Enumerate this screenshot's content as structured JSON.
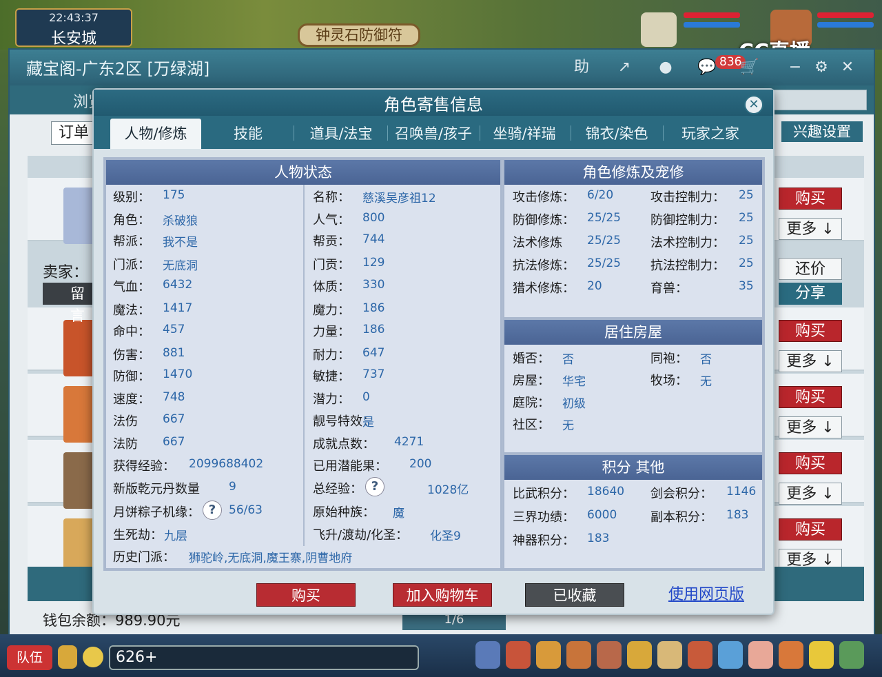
{
  "game": {
    "time": "22:43:37",
    "city": "长安城",
    "amulet": "钟灵石防御符",
    "stream_logo": "CC直播"
  },
  "window": {
    "title": "藏宝阁-广东2区 [万绿湖]",
    "toolbar": [
      "助",
      "↗",
      "●",
      "💬"
    ],
    "badge_count": "836",
    "nav_browse": "浏览",
    "order_btn": "订单",
    "interest_btn": "兴趣设置",
    "seller_label": "卖家：",
    "leave_msg": "留言",
    "counter_offer": "还价",
    "share": "分享",
    "buy": "购买",
    "more": "更多",
    "wallet": "钱包余额：989.90元",
    "pager": "1/6"
  },
  "modal": {
    "title": "角色寄售信息",
    "tabs": [
      "人物/修炼",
      "技能",
      "道具/法宝",
      "召唤兽/孩子",
      "坐骑/祥瑞",
      "锦衣/染色",
      "玩家之家"
    ],
    "sections": {
      "status": "人物状态",
      "cultivation": "角色修炼及宠修",
      "house": "居住房屋",
      "points": "积分 其他"
    },
    "status_left": [
      {
        "l": "级别：",
        "v": "175"
      },
      {
        "l": "角色：",
        "v": "杀破狼"
      },
      {
        "l": "帮派：",
        "v": "我不是"
      },
      {
        "l": "门派：",
        "v": "无底洞"
      },
      {
        "l": "气血：",
        "v": "6432"
      },
      {
        "l": "魔法：",
        "v": "1417"
      },
      {
        "l": "命中：",
        "v": "457"
      },
      {
        "l": "伤害：",
        "v": "881"
      },
      {
        "l": "防御：",
        "v": "1470"
      },
      {
        "l": "速度：",
        "v": "748"
      },
      {
        "l": "法伤",
        "v": "667"
      },
      {
        "l": "法防",
        "v": "667"
      },
      {
        "l": "获得经验：",
        "v": "2099688402"
      },
      {
        "l": "新版乾元丹数量",
        "v": "9"
      },
      {
        "l": "月饼粽子机缘：",
        "v": "56/63"
      },
      {
        "l": "生死劫：",
        "v": "九层"
      }
    ],
    "status_right": [
      {
        "l": "名称：",
        "v": "慈溪吴彦祖12"
      },
      {
        "l": "人气：",
        "v": "800"
      },
      {
        "l": "帮贡：",
        "v": "744"
      },
      {
        "l": "门贡：",
        "v": "129"
      },
      {
        "l": "体质：",
        "v": "330"
      },
      {
        "l": "魔力：",
        "v": "186"
      },
      {
        "l": "力量：",
        "v": "186"
      },
      {
        "l": "耐力：",
        "v": "647"
      },
      {
        "l": "敏捷：",
        "v": "737"
      },
      {
        "l": "潜力：",
        "v": "0"
      },
      {
        "l": "靓号特效：",
        "v": "是"
      },
      {
        "l": "成就点数：",
        "v": "4271"
      },
      {
        "l": "已用潜能果：",
        "v": "200"
      },
      {
        "l": "总经验：",
        "v": "1028亿"
      },
      {
        "l": "原始种族：",
        "v": "魔"
      },
      {
        "l": "飞升/渡劫/化圣：",
        "v": "化圣9"
      }
    ],
    "history_label": "历史门派：",
    "history_value": "狮驼岭,无底洞,魔王寨,阴曹地府",
    "cultivation": [
      {
        "l1": "攻击修炼：",
        "v1": "6/20",
        "l2": "攻击控制力：",
        "v2": "25"
      },
      {
        "l1": "防御修炼：",
        "v1": "25/25",
        "l2": "防御控制力：",
        "v2": "25"
      },
      {
        "l1": "法术修炼",
        "v1": "25/25",
        "l2": "法术控制力：",
        "v2": "25"
      },
      {
        "l1": "抗法修炼：",
        "v1": "25/25",
        "l2": "抗法控制力：",
        "v2": "25"
      },
      {
        "l1": "猎术修炼：",
        "v1": "20",
        "l2": "育兽：",
        "v2": "35"
      }
    ],
    "house": [
      {
        "l1": "婚否：",
        "v1": "否",
        "l2": "同袍：",
        "v2": "否"
      },
      {
        "l1": "房屋：",
        "v1": "华宅",
        "l2": "牧场：",
        "v2": "无"
      },
      {
        "l1": "庭院：",
        "v1": "初级"
      },
      {
        "l1": "社区：",
        "v1": "无"
      }
    ],
    "points": [
      {
        "l1": "比武积分：",
        "v1": "18640",
        "l2": "剑会积分：",
        "v2": "1146"
      },
      {
        "l1": "三界功绩：",
        "v1": "6000",
        "l2": "副本积分：",
        "v2": "183"
      },
      {
        "l1": "神器积分：",
        "v1": "183"
      }
    ],
    "btn_buy": "购买",
    "btn_cart": "加入购物车",
    "btn_fav": "已收藏",
    "btn_web": "使用网页版"
  },
  "bottom": {
    "team": "队伍",
    "chat_count": "626+"
  }
}
